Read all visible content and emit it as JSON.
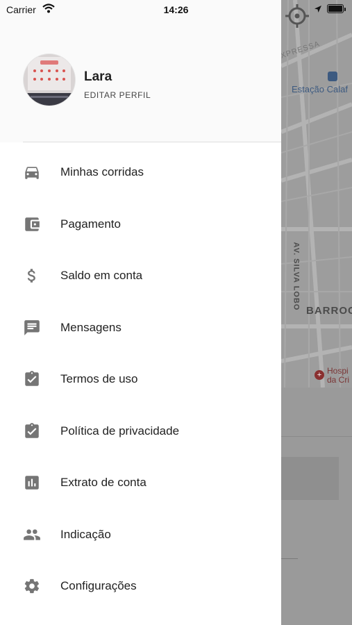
{
  "status_bar": {
    "carrier": "Carrier",
    "time": "14:26"
  },
  "profile": {
    "name": "Lara",
    "edit_label": "EDITAR PERFIL"
  },
  "menu": [
    {
      "label": "Minhas corridas",
      "icon": "car-icon"
    },
    {
      "label": "Pagamento",
      "icon": "wallet-icon"
    },
    {
      "label": "Saldo em conta",
      "icon": "dollar-icon"
    },
    {
      "label": "Mensagens",
      "icon": "message-icon"
    },
    {
      "label": "Termos de uso",
      "icon": "clipboard-check-icon"
    },
    {
      "label": "Política de privacidade",
      "icon": "clipboard-check-icon"
    },
    {
      "label": "Extrato de conta",
      "icon": "bar-chart-icon"
    },
    {
      "label": "Indicação",
      "icon": "people-icon"
    },
    {
      "label": "Configurações",
      "icon": "gear-icon"
    }
  ],
  "map": {
    "station_label": "Estação Calaf",
    "district_label": "BARROC",
    "street_label": "AV. SILVA LOBO",
    "road_label": "XPRESSA",
    "hospital_label_line1": "Hospi",
    "hospital_label_line2": "da Cri"
  },
  "colors": {
    "icon_gray": "#757575",
    "text_dark": "#222222",
    "overlay_gray": "#8a8a8a"
  }
}
